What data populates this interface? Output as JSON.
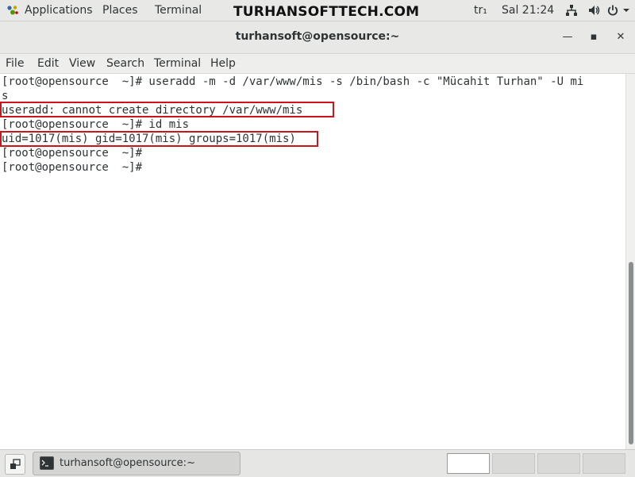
{
  "topbar": {
    "applications": "Applications",
    "places": "Places",
    "terminal": "Terminal",
    "brand": "TURHANSOFTTECH.COM",
    "locale": "tr₁",
    "clock": "Sal 21:24"
  },
  "window": {
    "title": "turhansoft@opensource:~",
    "minimize": "—",
    "maximize": "▪",
    "close": "✕"
  },
  "menu": {
    "file": "File",
    "edit": "Edit",
    "view": "View",
    "search": "Search",
    "terminal": "Terminal",
    "help": "Help"
  },
  "terminal": {
    "lines": [
      "[root@opensource  ~]# useradd -m -d /var/www/mis -s /bin/bash -c \"Mücahit Turhan\" -U mi",
      "s",
      "useradd: cannot create directory /var/www/mis",
      "[root@opensource  ~]# id mis",
      "uid=1017(mis) gid=1017(mis) groups=1017(mis)",
      "[root@opensource  ~]#",
      "[root@opensource  ~]#"
    ],
    "highlight_color": "#d0121b"
  },
  "taskbar": {
    "task_label": "turhansoft@opensource:~"
  },
  "icons": {
    "apps": "apps-icon",
    "network": "network-icon",
    "volume": "volume-icon",
    "power": "power-icon",
    "terminal": "terminal-icon",
    "show_desktop": "show-desktop-icon"
  },
  "colors": {
    "panel": "#e8e8e7",
    "text": "#2e3436",
    "highlight": "#d0121b"
  }
}
